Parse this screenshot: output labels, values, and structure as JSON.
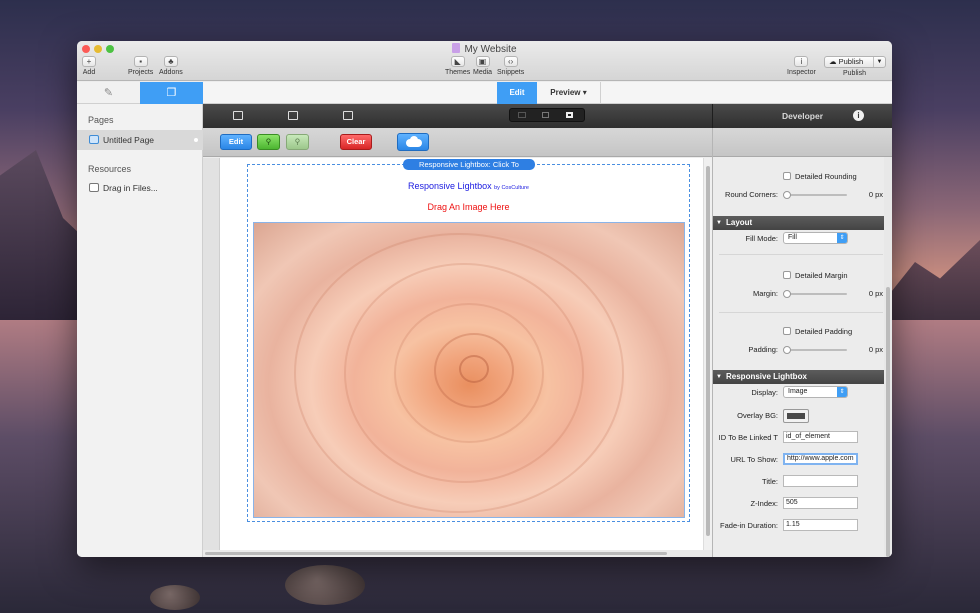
{
  "window": {
    "title": "My Website"
  },
  "toolbar": {
    "add_label": "Add",
    "projects_label": "Projects",
    "addons_label": "Addons",
    "themes_label": "Themes",
    "media_label": "Media",
    "snippets_label": "Snippets",
    "inspector_label": "Inspector",
    "publish_button": "Publish",
    "publish_label": "Publish"
  },
  "mode_tabs": {
    "edit": "Edit",
    "preview": "Preview"
  },
  "sidebar": {
    "pages_heading": "Pages",
    "pages": [
      {
        "label": "Untitled Page",
        "icon": "page-icon"
      }
    ],
    "resources_heading": "Resources",
    "resources": [
      {
        "label": "Drag in Files...",
        "icon": "file-icon"
      }
    ]
  },
  "editor_buttons": {
    "edit": "Edit",
    "clear": "Clear"
  },
  "canvas": {
    "lightbox_tab": "Responsive Lightbox: Click To",
    "lightbox_title": "Responsive Lightbox",
    "lightbox_byline": "by CosCulture",
    "drag_hint": "Drag An Image Here"
  },
  "inspector": {
    "title": "Developer",
    "detailed_rounding": "Detailed Rounding",
    "round_corners_label": "Round Corners:",
    "round_corners_value": "0 px",
    "layout_section": "Layout",
    "fill_mode_label": "Fill Mode:",
    "fill_mode_value": "Fill",
    "detailed_margin": "Detailed Margin",
    "margin_label": "Margin:",
    "margin_value": "0 px",
    "detailed_padding": "Detailed Padding",
    "padding_label": "Padding:",
    "padding_value": "0 px",
    "lightbox_section": "Responsive Lightbox",
    "display_label": "Display:",
    "display_value": "Image",
    "overlay_bg_label": "Overlay BG:",
    "overlay_bg_color": "#4a4a4a",
    "id_linked_label": "ID To Be Linked T",
    "id_linked_value": "id_of_element",
    "url_label": "URL To Show:",
    "url_value": "http://www.apple.com",
    "title_label": "Title:",
    "title_value": "",
    "zindex_label": "Z-Index:",
    "zindex_value": "505",
    "fade_label": "Fade-in Duration:",
    "fade_value": "1.15"
  },
  "colors": {
    "accent": "#3f9ef5",
    "edit_green": "#4cb531",
    "clear_red": "#d82626"
  }
}
